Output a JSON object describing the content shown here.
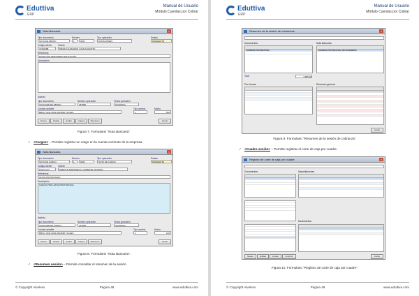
{
  "header": {
    "logo_name": "Eduttiva",
    "logo_sub": "ERP",
    "manual_title": "Manual de Usuario",
    "module_title": "Módulo Cuentas por Cobrar"
  },
  "left": {
    "win1": {
      "title": "Nota Bancaria",
      "labels": {
        "tipo_doc": "Tipo documento",
        "numero": "Número",
        "tipo_op": "Tipo operación",
        "estado": "Estado",
        "codigo_cliente": "Código cliente",
        "cliente": "Cliente",
        "referencia": "Referencia",
        "descripcion": "Descripción",
        "asiento": "Asiento",
        "tipo_documento2": "Tipo documento",
        "numero_op": "Número operación",
        "fecha_op": "Fecha operación",
        "cuenta_contable": "Cuenta contable",
        "tipo_cambio": "Tipo cambio",
        "monto": "Monto"
      },
      "values": {
        "tipo_doc": "NOTA DE ABONO",
        "serie": "1",
        "numero": "0001",
        "tipo_op": "DONACIONES",
        "estado": "PENDIENTE",
        "codigo_cliente": "72491488",
        "cliente": "PRADO ALVARADO JUAN AUGUSTO",
        "referencia": "DONACIÓN MINISTERIO EDUCACIÓN",
        "doc2": "VOUCHER DE ABONO",
        "numero_op": "457890",
        "fecha_op": "01/03/2011",
        "cuenta": "BBVA / 0011-0661-0614568 / SOLES",
        "tipo_cambio": "1",
        "monto": "500"
      },
      "buttons": [
        "Nuevo",
        "Grabar",
        "Anular",
        "Cargos",
        "Resumen",
        "Cerrar"
      ]
    },
    "caption1": "Figura 7. Formulario \"Nota Bancaria\".",
    "bullet1_term": "<Cargos>",
    "bullet1_text": " – Permite registrar un cargo en la cuenta corriente de la empresa.",
    "win2": {
      "title": "Nota Bancaria",
      "values": {
        "tipo_doc": "NOTA DE CARGO",
        "serie": "1",
        "numero": "0003",
        "tipo_op": "NOTA DE CARGO",
        "estado": "PENDIENTE",
        "codigo_cliente": "Proforma:3",
        "cliente": "PEROTTI MARTINEZ A. GILBERTE ANTONIO",
        "referencia": "LETRA PROTESTADA",
        "descripcion": "CARGO POR LETRA PROTESTADA",
        "doc2": "VOUCHER DE CARGO",
        "numero_op": "123456",
        "fecha_op": "31/03/2011",
        "cuenta": "BBVA / 0011-0661-0614568 / SOLES",
        "tipo_cambio": "1",
        "monto": "100"
      }
    },
    "caption2": "Figura 8. Formulario \"Nota Bancaria\".",
    "bullet2_term": "<Resumen sesión>",
    "bullet2_text": " – Permite consultar el resumen de la sesión.",
    "footer": {
      "copyright": "© Copyright Alvelera",
      "page": "Página 48",
      "site": "www.eduttiva.com"
    }
  },
  "right": {
    "win3": {
      "title": "Resumen de la sesión de cobranzas",
      "panel_left": "Documentos",
      "panel_right": "Nota Bancaria",
      "section_bottom_left": "Por formas",
      "section_bottom_right": "Resumen general",
      "row_left": "CARRERA PROFESIONAL",
      "row_right": "CARRERA PROFESIONAL DE INGENIERÍA",
      "total_label": "Total",
      "total_value": "3,655.00",
      "button": "Cerrar"
    },
    "caption3": "Figura 9. Formulario \"Resumen de la sesión de cobranza\".",
    "bullet3_term": "<Cuadre sesión>",
    "bullet3_text": " – Permite registrar el corte de caja por cuadre.",
    "win4": {
      "title": "Registro de corte de caja por cuadre",
      "section_docs": "Documentos",
      "section_deps": "Depositaciones",
      "section_movs": "Movimientos",
      "buttons": [
        "Nuevo",
        "Grabar",
        "Anular",
        "Imprimir",
        "Cerrar"
      ]
    },
    "caption4": "Figura 10. Formulario \"Registro de corte de caja por cuadre\".",
    "footer": {
      "copyright": "© Copyright Alvelera",
      "page": "Página 49",
      "site": "www.eduttiva.com"
    }
  }
}
